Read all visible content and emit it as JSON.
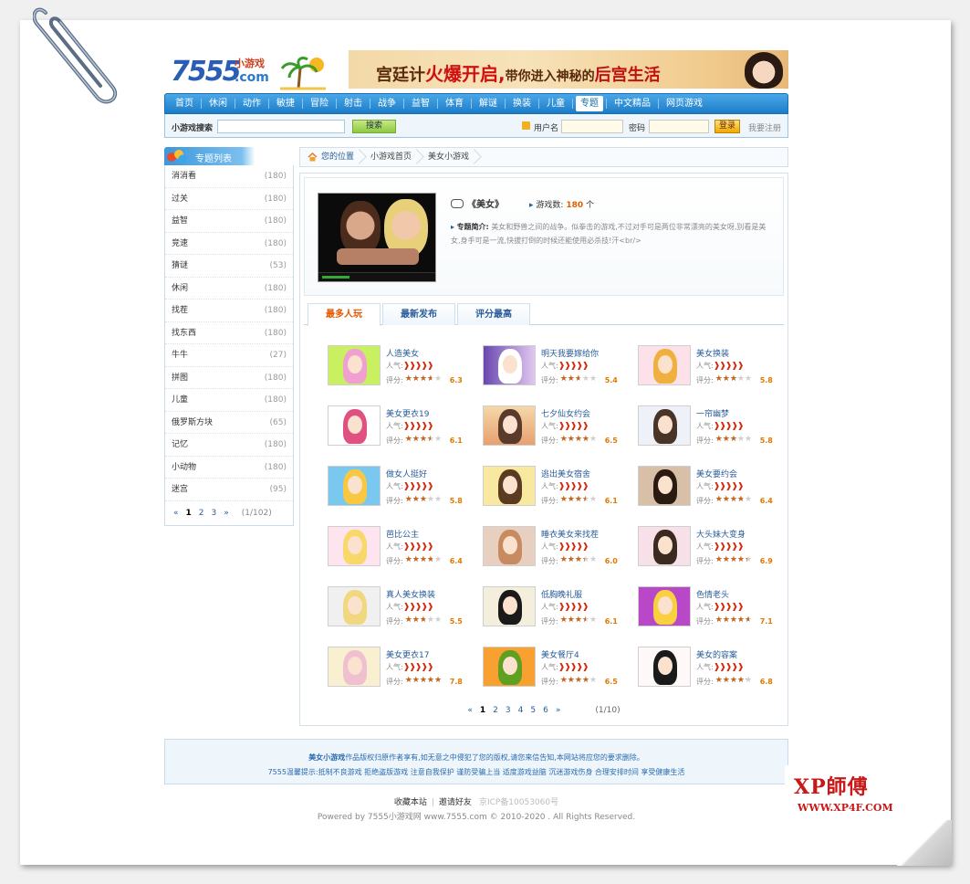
{
  "logo": {
    "num": "7555",
    "cn": "小游戏",
    "com": ".com"
  },
  "banner": {
    "text_a": "宫廷计",
    "text_hot": "火爆开启,",
    "text_b": "带你进入神秘的",
    "text_c": "后宫生活"
  },
  "nav": [
    "首页",
    "休闲",
    "动作",
    "敏捷",
    "冒险",
    "射击",
    "战争",
    "益智",
    "体育",
    "解谜",
    "换装",
    "儿童",
    "专题",
    "中文精品",
    "网页游戏"
  ],
  "nav_active_index": 12,
  "search": {
    "label": "小游戏搜索",
    "button": "搜索",
    "value": ""
  },
  "login": {
    "user_label": "用户名",
    "pass_label": "密码",
    "login_button": "登录",
    "register": "我要注册"
  },
  "sidebar": {
    "title": "专题列表",
    "items": [
      {
        "name": "消消看",
        "count": "(180)"
      },
      {
        "name": "过关",
        "count": "(180)"
      },
      {
        "name": "益智",
        "count": "(180)"
      },
      {
        "name": "竞速",
        "count": "(180)"
      },
      {
        "name": "猜谜",
        "count": "(53)"
      },
      {
        "name": "休闲",
        "count": "(180)"
      },
      {
        "name": "找茬",
        "count": "(180)"
      },
      {
        "name": "找东西",
        "count": "(180)"
      },
      {
        "name": "牛牛",
        "count": "(27)"
      },
      {
        "name": "拼图",
        "count": "(180)"
      },
      {
        "name": "儿童",
        "count": "(180)"
      },
      {
        "name": "俄罗斯方块",
        "count": "(65)"
      },
      {
        "name": "记忆",
        "count": "(180)"
      },
      {
        "name": "小动物",
        "count": "(180)"
      },
      {
        "name": "迷宫",
        "count": "(95)"
      }
    ],
    "pager": {
      "prev": "«",
      "pages": [
        "1",
        "2",
        "3"
      ],
      "next": "»",
      "info": "(1/102)"
    }
  },
  "breadcrumb": {
    "location": "您的位置",
    "home": "小游戏首页",
    "current": "美女小游戏"
  },
  "topic": {
    "title": "《美女》",
    "count_label": "游戏数:",
    "count_value": "180",
    "count_unit": "个",
    "desc_label": "专题简介:",
    "desc": "美女和野兽之间的战争。似拳击的游戏,不过对手可是两位非常漂亮的美女呀,别看是美女,身手可是一流,快拔打倒的时候还能使用必杀技!汗<br/>"
  },
  "tabs": [
    "最多人玩",
    "最新发布",
    "评分最高"
  ],
  "tab_active_index": 0,
  "labels": {
    "popularity": "人气:",
    "rating": "评分:",
    "peppers": "❱❱❱❱❱"
  },
  "games": [
    {
      "name": "人造美女",
      "rating": 6.3,
      "art": "a"
    },
    {
      "name": "明天我要嫁给你",
      "rating": 5.4,
      "art": "b"
    },
    {
      "name": "美女换装",
      "rating": 5.8,
      "art": "c"
    },
    {
      "name": "美女更衣19",
      "rating": 6.1,
      "art": "d"
    },
    {
      "name": "七夕仙女约会",
      "rating": 6.5,
      "art": "e"
    },
    {
      "name": "一帘幽梦",
      "rating": 5.8,
      "art": "f"
    },
    {
      "name": "做女人挺好",
      "rating": 5.8,
      "art": "g"
    },
    {
      "name": "逃出美女宿舍",
      "rating": 6.1,
      "art": "h"
    },
    {
      "name": "美女要约会",
      "rating": 6.4,
      "art": "i"
    },
    {
      "name": "芭比公主",
      "rating": 6.4,
      "art": "j"
    },
    {
      "name": "睡衣美女来找茬",
      "rating": 6.0,
      "art": "k"
    },
    {
      "name": "大头妹大变身",
      "rating": 6.9,
      "art": "l"
    },
    {
      "name": "真人美女换装",
      "rating": 5.5,
      "art": "m"
    },
    {
      "name": "低胸晚礼服",
      "rating": 6.1,
      "art": "n"
    },
    {
      "name": "色情老头",
      "rating": 7.1,
      "art": "o"
    },
    {
      "name": "美女更衣17",
      "rating": 7.8,
      "art": "p"
    },
    {
      "name": "美女餐厅4",
      "rating": 6.5,
      "art": "q"
    },
    {
      "name": "美女的容案",
      "rating": 6.8,
      "art": "r"
    }
  ],
  "pager": {
    "prev": "«",
    "pages": [
      "1",
      "2",
      "3",
      "4",
      "5",
      "6"
    ],
    "next": "»",
    "info": "(1/10)"
  },
  "notice": {
    "line1_strong": "美女小游戏",
    "line1": "作品版权归原作者享有,如无意之中侵犯了您的版权,请您来信告知,本网站将应您的要求删除。",
    "line2": "7555温馨提示:抵制不良游戏  拒绝盗版游戏  注意自我保护  谨防受骗上当  适度游戏益脑  沉迷游戏伤身  合理安排时间  享受健康生活"
  },
  "footer": {
    "bookmark": "收藏本站",
    "invite": "邀请好友",
    "icp": "京ICP备10053060号",
    "copyright": "Powered by 7555小游戏网 www.7555.com © 2010-2020 . All Rights Reserved."
  },
  "watermark": {
    "title": "XP師傅",
    "url": "WWW.XP4F.COM"
  }
}
